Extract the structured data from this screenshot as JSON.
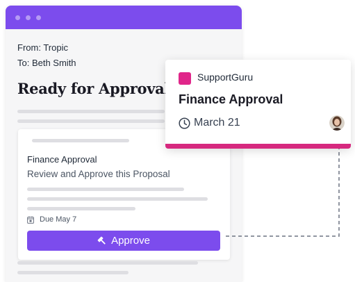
{
  "email": {
    "from_line": "From: Tropic",
    "to_line": "To: Beth Smith",
    "title": "Ready for Approval",
    "card": {
      "title": "Finance Approval",
      "subtitle": "Review and Approve this Proposal",
      "due": "Due May 7",
      "approve_label": "Approve"
    }
  },
  "notification": {
    "brand": "SupportGuru",
    "title": "Finance Approval",
    "date": "March 21"
  },
  "colors": {
    "accent_purple": "#7c4ced",
    "brand_pink": "#e0268a",
    "notify_bar": "#d6297f"
  },
  "icons": {
    "due_date": "calendar-icon",
    "approve": "gavel-icon",
    "date": "clock-icon"
  }
}
